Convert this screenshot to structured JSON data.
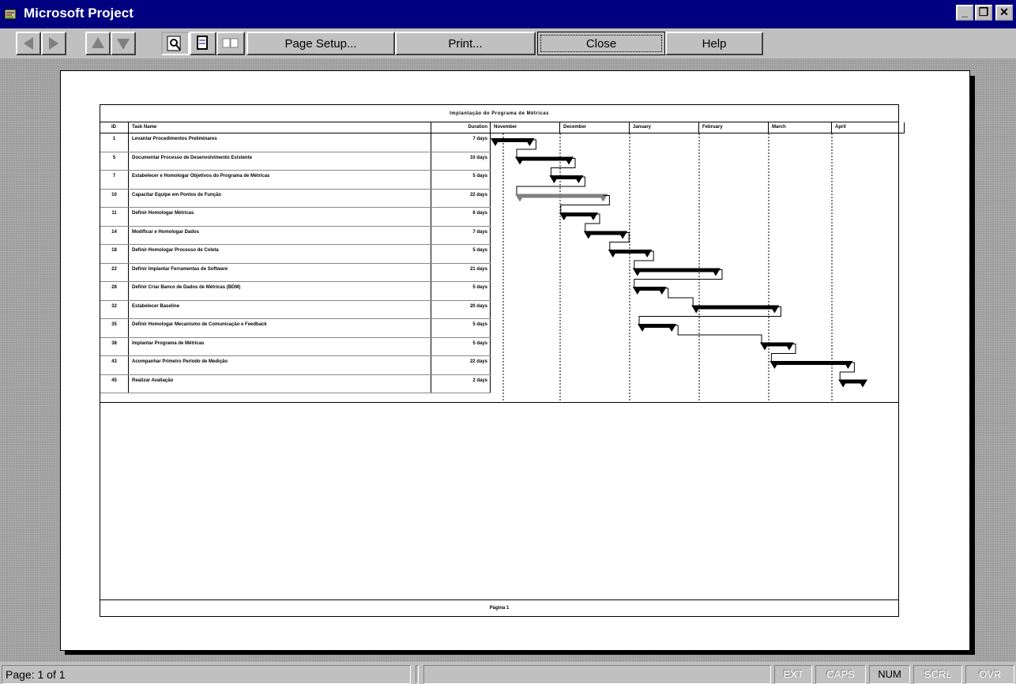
{
  "window": {
    "title": "Microsoft Project",
    "minimize_icon": "minimize-icon",
    "restore_icon": "restore-icon",
    "close_icon": "close-icon"
  },
  "toolbar": {
    "nav_icons": [
      "arrow-left-icon",
      "arrow-right-icon",
      "arrow-up-icon",
      "arrow-down-icon"
    ],
    "view_icons": [
      "zoom-icon",
      "one-page-icon",
      "multiple-pages-icon"
    ],
    "page_setup_label": "Page Setup...",
    "print_label": "Print...",
    "close_label": "Close",
    "help_label": "Help"
  },
  "report": {
    "title": "Implantação do Programa de Métricas",
    "columns": {
      "id": "ID",
      "name": "Task Name",
      "duration": "Duration"
    },
    "months": [
      "November",
      "December",
      "January",
      "February",
      "March",
      "April"
    ],
    "footer": "Página 1"
  },
  "tasks": [
    {
      "id": "1",
      "name": "Levantar Procedimentos Preliminares",
      "duration": "7 days",
      "start": 0,
      "length": 7,
      "summary": true
    },
    {
      "id": "5",
      "name": "Documentar Processo de Desenvolvimento Existente",
      "duration": "10 days",
      "start": 5,
      "length": 10,
      "summary": true
    },
    {
      "id": "7",
      "name": "Estabelecer e Homologar Objetivos do Programa de Métricas",
      "duration": "5 days",
      "start": 12,
      "length": 5,
      "summary": true
    },
    {
      "id": "10",
      "name": "Capacitar Equipe em Pontos de Função",
      "duration": "22 days",
      "start": 5,
      "length": 17,
      "summary": true,
      "gray": true
    },
    {
      "id": "11",
      "name": "Definir Homologar Métricas",
      "duration": "6 days",
      "start": 14,
      "length": 6,
      "summary": true
    },
    {
      "id": "14",
      "name": "Modificar e Homologar Dados",
      "duration": "7 days",
      "start": 19,
      "length": 7,
      "summary": true
    },
    {
      "id": "18",
      "name": "Definir Homologar Processo de Coleta",
      "duration": "5 days",
      "start": 24,
      "length": 7,
      "summary": true
    },
    {
      "id": "22",
      "name": "Definir Implantar Ferramentas de Software",
      "duration": "21 days",
      "start": 29,
      "length": 16,
      "summary": true
    },
    {
      "id": "28",
      "name": "Definir Criar Banco de Dados de Métricas (BDM)",
      "duration": "5 days",
      "start": 29,
      "length": 5,
      "summary": true
    },
    {
      "id": "32",
      "name": "Estabelecer Baseline",
      "duration": "20 days",
      "start": 41,
      "length": 16,
      "summary": true
    },
    {
      "id": "35",
      "name": "Definir Homologar Mecanismo de Comunicação e Feedback",
      "duration": "5 days",
      "start": 30,
      "length": 6,
      "summary": true
    },
    {
      "id": "38",
      "name": "Implantar Programa de Métricas",
      "duration": "5 days",
      "start": 55,
      "length": 5,
      "summary": true
    },
    {
      "id": "43",
      "name": "Acompanhar Primeiro Período de Medição",
      "duration": "22 days",
      "start": 57,
      "length": 15,
      "summary": true
    },
    {
      "id": "45",
      "name": "Realizar Avaliação",
      "duration": "2 days",
      "start": 71,
      "length": 4,
      "summary": true
    }
  ],
  "statusbar": {
    "page_label": "Page: 1 of 1",
    "indicators": [
      {
        "label": "EXT",
        "active": false
      },
      {
        "label": "CAPS",
        "active": false
      },
      {
        "label": "NUM",
        "active": true
      },
      {
        "label": "SCRL",
        "active": false
      },
      {
        "label": "OVR",
        "active": false
      }
    ]
  }
}
